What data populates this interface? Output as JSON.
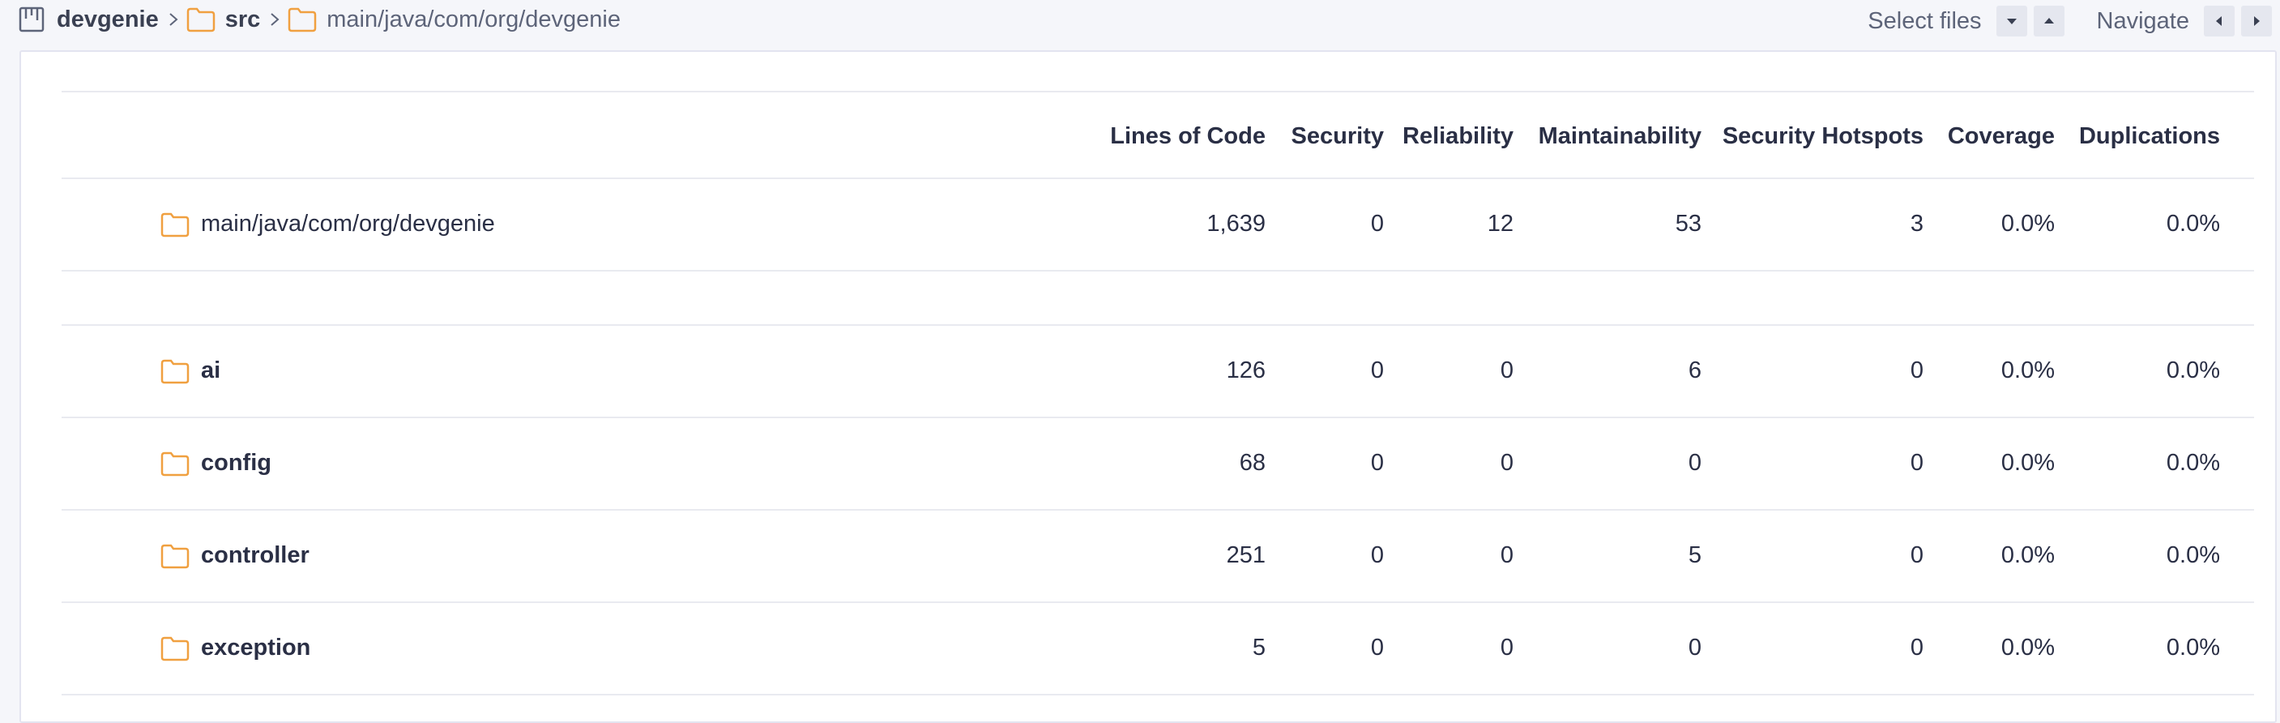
{
  "breadcrumb": {
    "project": "devgenie",
    "folder1": "src",
    "folder2": "main/java/com/org/devgenie"
  },
  "actions": {
    "select_files": "Select files",
    "navigate": "Navigate"
  },
  "table": {
    "headers": [
      "Lines of Code",
      "Security",
      "Reliability",
      "Maintainability",
      "Security Hotspots",
      "Coverage",
      "Duplications"
    ],
    "summary_row": {
      "name": "main/java/com/org/devgenie",
      "values": [
        "1,639",
        "0",
        "12",
        "53",
        "3",
        "0.0%",
        "0.0%"
      ]
    },
    "rows": [
      {
        "name": "ai",
        "values": [
          "126",
          "0",
          "0",
          "6",
          "0",
          "0.0%",
          "0.0%"
        ]
      },
      {
        "name": "config",
        "values": [
          "68",
          "0",
          "0",
          "0",
          "0",
          "0.0%",
          "0.0%"
        ]
      },
      {
        "name": "controller",
        "values": [
          "251",
          "0",
          "0",
          "5",
          "0",
          "0.0%",
          "0.0%"
        ]
      },
      {
        "name": "exception",
        "values": [
          "5",
          "0",
          "0",
          "0",
          "0",
          "0.0%",
          "0.0%"
        ]
      }
    ]
  },
  "colors": {
    "folder_icon": "#f0a040",
    "text": "#2a2f45",
    "muted": "#5d6479",
    "border": "#e9eaf0"
  }
}
